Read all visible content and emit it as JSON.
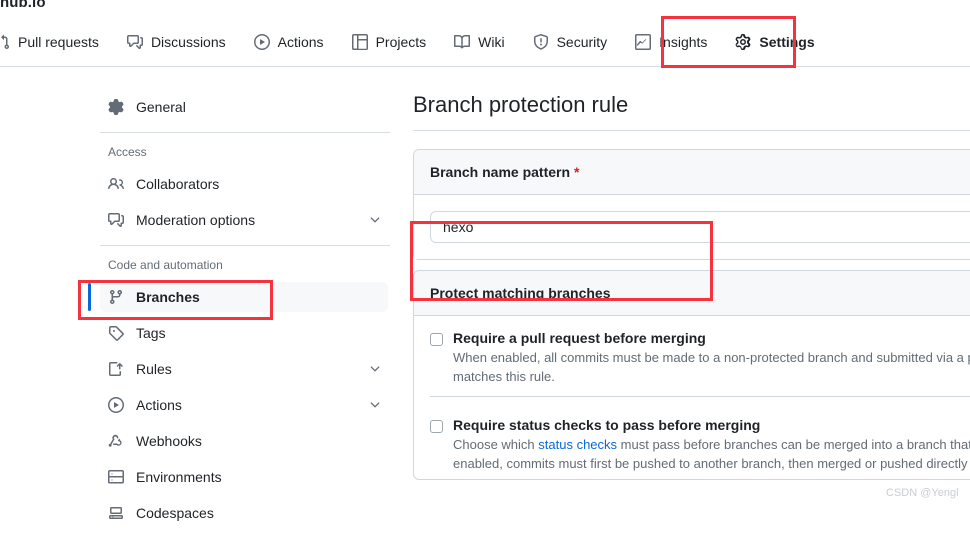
{
  "repo": {
    "name_fragment": "hub.io"
  },
  "repo_nav": {
    "items": [
      {
        "label": "Pull requests",
        "icon": "git-pull-request-icon",
        "active": false
      },
      {
        "label": "Discussions",
        "icon": "comment-discussion-icon",
        "active": false
      },
      {
        "label": "Actions",
        "icon": "play-circle-icon",
        "active": false
      },
      {
        "label": "Projects",
        "icon": "table-icon",
        "active": false
      },
      {
        "label": "Wiki",
        "icon": "book-icon",
        "active": false
      },
      {
        "label": "Security",
        "icon": "shield-icon",
        "active": false
      },
      {
        "label": "Insights",
        "icon": "graph-icon",
        "active": false
      },
      {
        "label": "Settings",
        "icon": "gear-icon",
        "active": true
      }
    ],
    "active_underline_color": "#fd8c73"
  },
  "sidebar": {
    "top_items": [
      {
        "label": "General",
        "icon": "gear-icon"
      }
    ],
    "groups": [
      {
        "label": "Access",
        "items": [
          {
            "label": "Collaborators",
            "icon": "people-icon",
            "chevron": false
          },
          {
            "label": "Moderation options",
            "icon": "comment-discussion-icon",
            "chevron": true
          }
        ]
      },
      {
        "label": "Code and automation",
        "items": [
          {
            "label": "Branches",
            "icon": "git-branch-icon",
            "chevron": false,
            "selected": true
          },
          {
            "label": "Tags",
            "icon": "tag-icon",
            "chevron": false
          },
          {
            "label": "Rules",
            "icon": "rules-icon",
            "chevron": true
          },
          {
            "label": "Actions",
            "icon": "play-circle-icon",
            "chevron": true
          },
          {
            "label": "Webhooks",
            "icon": "webhook-icon",
            "chevron": false
          },
          {
            "label": "Environments",
            "icon": "server-icon",
            "chevron": false
          },
          {
            "label": "Codespaces",
            "icon": "codespaces-icon",
            "chevron": false
          }
        ]
      }
    ],
    "selected_indicator_color": "#0969da"
  },
  "main": {
    "page_title": "Branch protection rule",
    "branch_pattern": {
      "label": "Branch name pattern",
      "required_marker": "*",
      "value": "hexo",
      "placeholder": ""
    },
    "protect_section": {
      "header": "Protect matching branches",
      "checks": [
        {
          "title": "Require a pull request before merging",
          "checked": false,
          "desc_before": "When enabled, all commits must be made to a non-protected branch and submitted via a pull request. ",
          "link": "",
          "desc_after": "a branch that matches this rule."
        },
        {
          "title": "Require status checks to pass before merging",
          "checked": false,
          "desc_before": "Choose which ",
          "link": "status checks",
          "desc_after": " must pass before branches can be merged into a branch that matches this rule. When enabled, commits must first be pushed to another branch, then merged or pushed directly to a branch that matches"
        }
      ]
    }
  },
  "annotations": {
    "color": "#f5333f",
    "boxes": [
      {
        "name": "settings-tab-highlight"
      },
      {
        "name": "branches-sidebar-highlight"
      },
      {
        "name": "branch-name-input-highlight"
      }
    ]
  },
  "watermark": {
    "text": "CSDN @Yengl"
  }
}
